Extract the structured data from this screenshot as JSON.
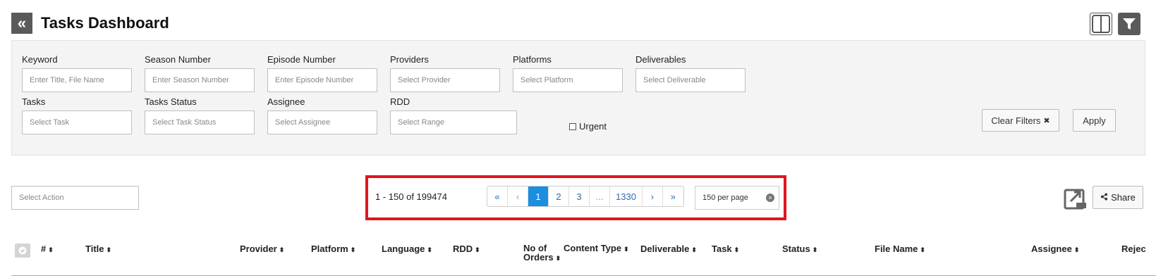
{
  "header": {
    "back_icon": "double-chevron-left-icon",
    "title": "Tasks Dashboard"
  },
  "top_buttons": {
    "columns_icon": "columns-toggle-icon",
    "filter_icon": "filter-icon"
  },
  "filters": {
    "keyword": {
      "label": "Keyword",
      "placeholder": "Enter Title, File Name"
    },
    "season": {
      "label": "Season Number",
      "placeholder": "Enter Season Number"
    },
    "episode": {
      "label": "Episode Number",
      "placeholder": "Enter Episode Number"
    },
    "providers": {
      "label": "Providers",
      "placeholder": "Select Provider"
    },
    "platforms": {
      "label": "Platforms",
      "placeholder": "Select Platform"
    },
    "deliverables": {
      "label": "Deliverables",
      "placeholder": "Select Deliverable"
    },
    "tasks": {
      "label": "Tasks",
      "placeholder": "Select Task"
    },
    "task_status": {
      "label": "Tasks Status",
      "placeholder": "Select Task Status"
    },
    "assignee": {
      "label": "Assignee",
      "placeholder": "Select Assignee"
    },
    "rdd": {
      "label": "RDD",
      "placeholder": "Select Range"
    },
    "urgent_label": "Urgent",
    "urgent_checked": false,
    "clear_label": "Clear Filters",
    "clear_icon": "✖",
    "apply_label": "Apply"
  },
  "toolbar": {
    "action_placeholder": "Select Action",
    "range_text": "1 - 150 of 199474",
    "pages": [
      "«",
      "‹",
      "1",
      "2",
      "3",
      "...",
      "1330",
      "›",
      "»"
    ],
    "active_page": "1",
    "per_page": "150 per page",
    "csv_icon": "csv-export-icon",
    "share_label": "Share",
    "share_icon": "share-icon"
  },
  "table": {
    "headers": [
      "#",
      "Title",
      "Provider",
      "Platform",
      "Language",
      "RDD",
      "No of Orders",
      "Content Type",
      "Deliverable",
      "Task",
      "Status",
      "File Name",
      "Assignee",
      "Rejec"
    ],
    "sort_glyph": "⬍"
  }
}
